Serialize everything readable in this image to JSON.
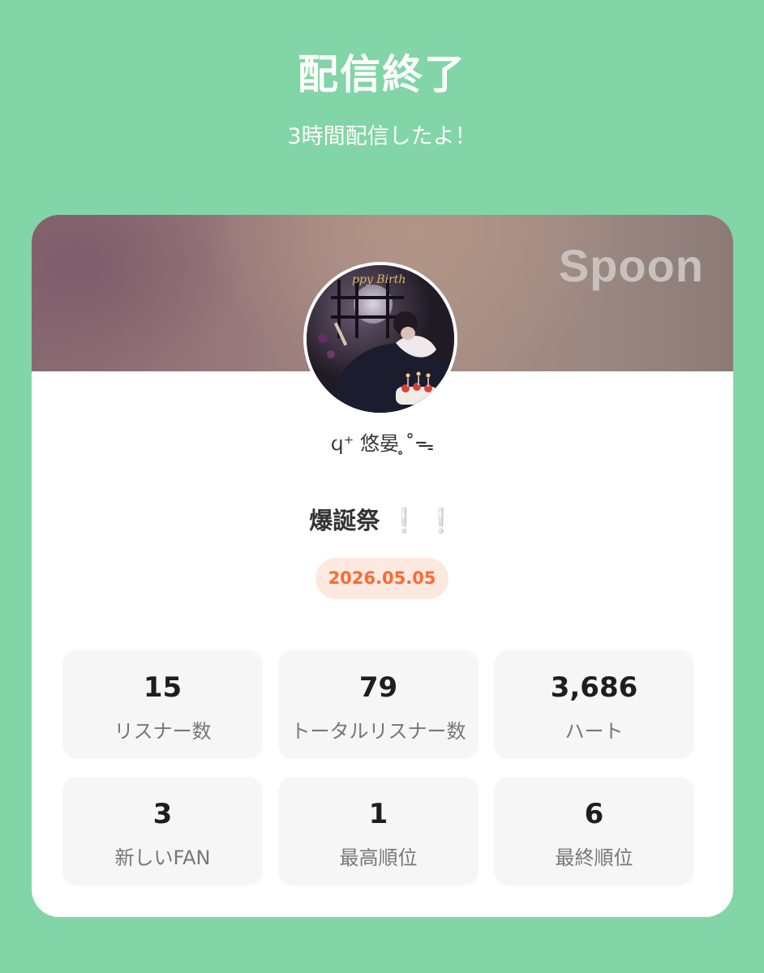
{
  "header": {
    "title": "配信終了",
    "subtitle": "3時間配信したよ！"
  },
  "card": {
    "brand": "Spoon",
    "username": "ϥ⁺ 悠晏 ̥˚ᯓ",
    "stream_title": "爆誕祭",
    "stream_title_suffix": "❕ ❕",
    "date": "2026.05.05"
  },
  "stats": [
    {
      "value": "15",
      "label": "リスナー数"
    },
    {
      "value": "79",
      "label": "トータルリスナー数"
    },
    {
      "value": "3,686",
      "label": "ハート"
    },
    {
      "value": "3",
      "label": "新しいFAN"
    },
    {
      "value": "1",
      "label": "最高順位"
    },
    {
      "value": "6",
      "label": "最終順位"
    }
  ],
  "colors": {
    "background": "#82d5a6",
    "date_accent": "#ff6a2f",
    "date_badge_bg": "#fde9e0"
  }
}
